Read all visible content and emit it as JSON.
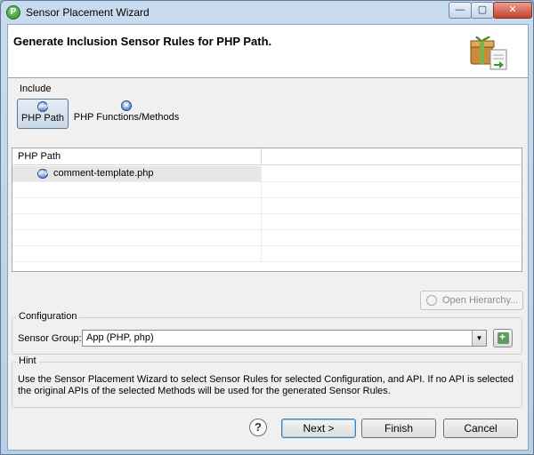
{
  "window": {
    "title": "Sensor Placement Wizard",
    "app_icon_letter": "P",
    "controls": {
      "minimize": "—",
      "maximize": "▢",
      "close": "✕"
    }
  },
  "header": {
    "title": "Generate Inclusion Sensor Rules for PHP Path."
  },
  "include": {
    "label": "Include",
    "options": [
      {
        "label": "PHP Path",
        "icon": "php-icon",
        "selected": true
      },
      {
        "label": "PHP Functions/Methods",
        "icon": "php-methods-icon",
        "selected": false
      }
    ]
  },
  "table": {
    "columns": [
      "PHP Path",
      ""
    ],
    "rows": [
      {
        "path": "comment-template.php",
        "selected": true
      }
    ]
  },
  "open_hierarchy": {
    "label": "Open Hierarchy...",
    "enabled": false
  },
  "configuration": {
    "label": "Configuration",
    "sensor_group_label": "Sensor Group:",
    "sensor_group_value": "App (PHP, php)"
  },
  "hint": {
    "label": "Hint",
    "text": "Use the Sensor Placement Wizard to select Sensor Rules for selected Configuration, and API. If no API is selected the original APIs of the selected Methods will be used for the generated Sensor Rules."
  },
  "footer": {
    "help": "?",
    "next": "Next >",
    "finish": "Finish",
    "cancel": "Cancel"
  }
}
